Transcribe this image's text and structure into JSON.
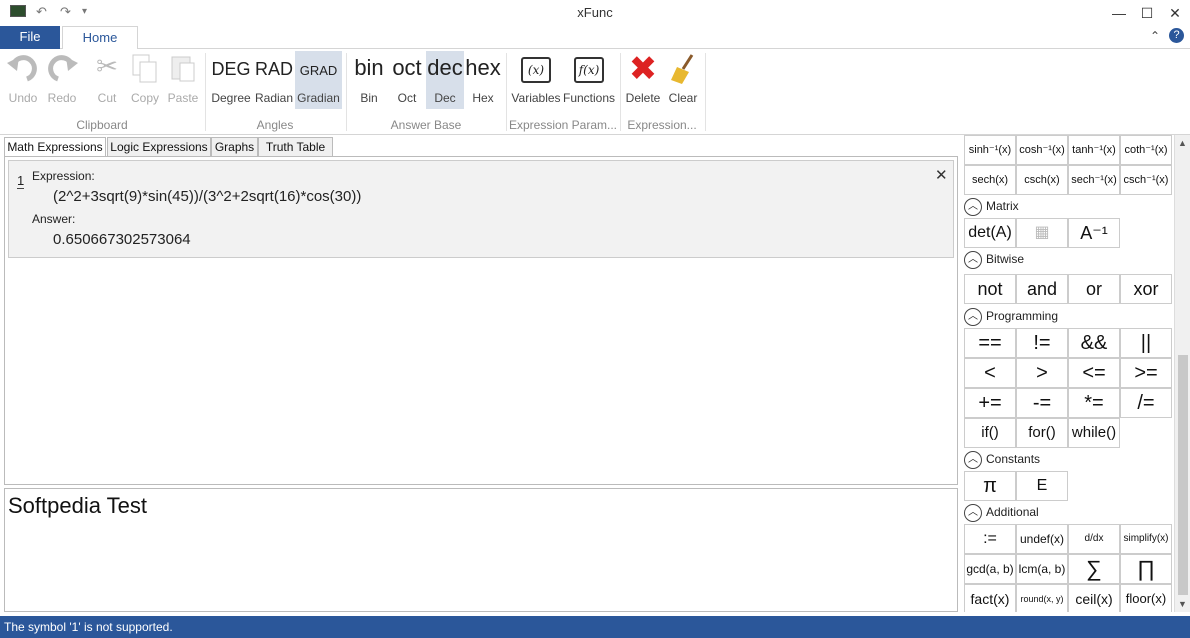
{
  "window": {
    "title": "xFunc"
  },
  "tabs": {
    "file": "File",
    "home": "Home"
  },
  "ribbon": {
    "clipboard": {
      "undo": "Undo",
      "redo": "Redo",
      "cut": "Cut",
      "copy": "Copy",
      "paste": "Paste",
      "group": "Clipboard"
    },
    "angles": {
      "deg_big": "DEG",
      "deg": "Degree",
      "rad_big": "RAD",
      "rad": "Radian",
      "grad_big": "GRAD",
      "grad": "Gradian",
      "group": "Angles"
    },
    "base": {
      "bin_big": "bin",
      "bin": "Bin",
      "oct_big": "oct",
      "oct": "Oct",
      "dec_big": "dec",
      "dec": "Dec",
      "hex_big": "hex",
      "hex": "Hex",
      "group": "Answer Base"
    },
    "params": {
      "variables_glyph": "(x)",
      "variables": "Variables",
      "functions_glyph": "f(x)",
      "functions": "Functions",
      "group": "Expression Param..."
    },
    "expr": {
      "delete": "Delete",
      "clear": "Clear",
      "group": "Expression..."
    }
  },
  "doc_tabs": [
    "Math Expressions",
    "Logic Expressions",
    "Graphs",
    "Truth Table"
  ],
  "expression": {
    "index": "1",
    "label": "Expression:",
    "text": "(2^2+3sqrt(9)*sin(45))/(3^2+2sqrt(16)*cos(30))",
    "answer_label": "Answer:",
    "answer": "0.650667302573064"
  },
  "notes": "Softpedia Test",
  "panel": {
    "hyperbolic": [
      "sinh⁻¹(x)",
      "cosh⁻¹(x)",
      "tanh⁻¹(x)",
      "coth⁻¹(x)",
      "sech(x)",
      "csch(x)",
      "sech⁻¹(x)",
      "csch⁻¹(x)"
    ],
    "matrix_title": "Matrix",
    "matrix": [
      "det(A)",
      "",
      "A⁻¹"
    ],
    "bitwise_title": "Bitwise",
    "bitwise": [
      "not",
      "and",
      "or",
      "xor"
    ],
    "programming_title": "Programming",
    "programming": [
      "==",
      "!=",
      "&&",
      "||",
      "<",
      ">",
      "<=",
      ">=",
      "+=",
      "-=",
      "*=",
      "/=",
      "if()",
      "for()",
      "while()"
    ],
    "constants_title": "Constants",
    "constants": [
      "π",
      "E"
    ],
    "additional_title": "Additional",
    "additional": [
      ":=",
      "undef(x)",
      "d/dx",
      "simplify(x)",
      "gcd(a, b)",
      "lcm(a, b)",
      "∑",
      "∏",
      "fact(x)",
      "round(x, y)",
      "ceil(x)",
      "floor(x)"
    ]
  },
  "status": "The symbol '1' is not supported."
}
